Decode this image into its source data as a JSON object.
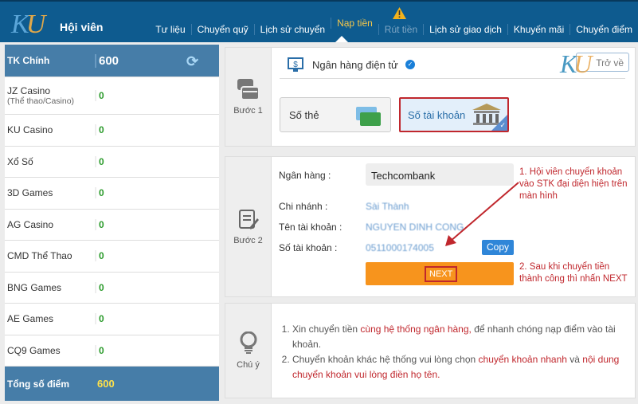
{
  "header": {
    "logo": "KU",
    "title": "Hội viên",
    "nav": [
      "Tư liệu",
      "Chuyển quỹ",
      "Lịch sử chuyển",
      "Nạp tiền",
      "Rút tiền",
      "Lịch sử giao dịch",
      "Khuyến mãi",
      "Chuyển điểm"
    ],
    "active": "Nạp tiền"
  },
  "sidebar": {
    "main": {
      "label": "TK Chính",
      "value": "600"
    },
    "items": [
      {
        "label": "JZ Casino",
        "sub": "(Thể thao/Casino)",
        "value": "0"
      },
      {
        "label": "KU Casino",
        "value": "0"
      },
      {
        "label": "Xổ Số",
        "value": "0"
      },
      {
        "label": "3D Games",
        "value": "0"
      },
      {
        "label": "AG Casino",
        "value": "0"
      },
      {
        "label": "CMD Thể Thao",
        "value": "0"
      },
      {
        "label": "BNG Games",
        "value": "0"
      },
      {
        "label": "AE Games",
        "value": "0"
      },
      {
        "label": "CQ9 Games",
        "value": "0"
      }
    ],
    "total": {
      "label": "Tổng số điểm",
      "value": "600"
    }
  },
  "step1": {
    "label": "Bước 1",
    "method": "Ngân hàng điện tử",
    "back": "Trở về",
    "options": [
      "Số thẻ",
      "Số tài khoản"
    ],
    "selected": "Số tài khoản"
  },
  "step2": {
    "label": "Bước 2",
    "fields": [
      {
        "label": "Ngân hàng :",
        "value": "Techcombank"
      },
      {
        "label": "Chi nhánh :",
        "value": "Sài Thành"
      },
      {
        "label": "Tên tài khoản :",
        "value": "NGUYEN DINH CONG"
      },
      {
        "label": "Số tài khoản :",
        "value": "0511000174005"
      }
    ],
    "copy": "Copy",
    "next": "NEXT",
    "annotations": [
      "1. Hội viên chuyển khoản vào STK đại diện hiện trên màn hình",
      "2. Sau khi chuyển tiền thành công thì nhấn NEXT"
    ]
  },
  "step3": {
    "label": "Chú ý",
    "note1": {
      "a": "Xin chuyển tiền ",
      "b": "cùng hệ thống ngân hàng,",
      "c": " để nhanh chóng nạp điểm vào tài khoản."
    },
    "note2": {
      "a": "Chuyển khoản khác hệ thống vui lòng chọn ",
      "b": "chuyển khoản nhanh",
      "c": " và ",
      "d": "nội dung chuyển khoản vui lòng điền họ tên."
    }
  },
  "colors": {
    "header": "#0e5b8f",
    "sidebar": "#467da8",
    "next": "#f7941d",
    "highlight": "#c0272d"
  }
}
